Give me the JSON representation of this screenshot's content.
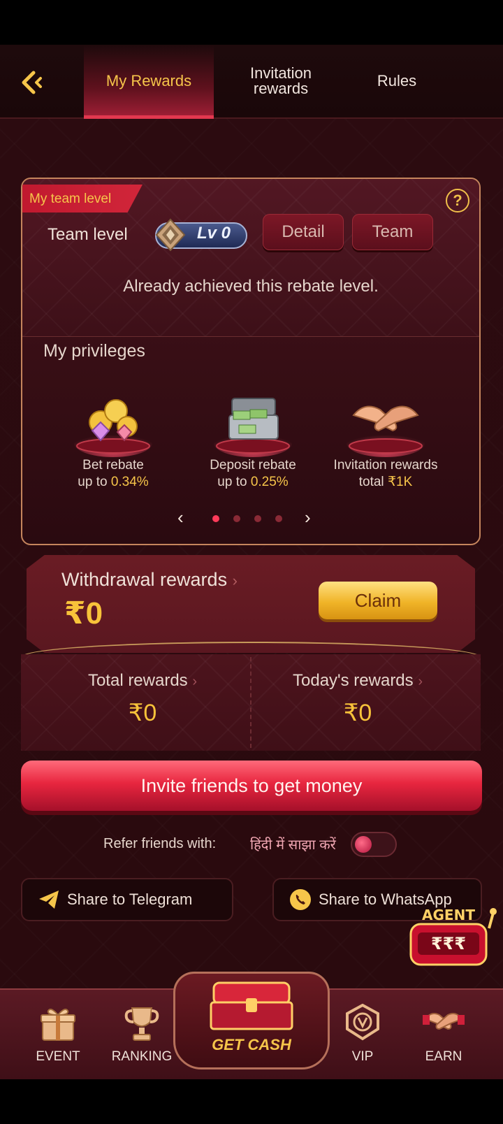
{
  "header": {
    "tabs": [
      {
        "label": "My Rewards",
        "active": true
      },
      {
        "label_line1": "Invitation",
        "label_line2": "rewards"
      },
      {
        "label": "Rules"
      }
    ]
  },
  "team_card": {
    "ribbon": "My team level",
    "team_level_label": "Team level",
    "level_badge": "Lv 0",
    "detail_button": "Detail",
    "team_button": "Team",
    "status_text": "Already achieved this rebate level.",
    "privileges_title": "My privileges",
    "privileges": [
      {
        "line1": "Bet rebate",
        "line2_prefix": "up to ",
        "line2_value": "0.34%"
      },
      {
        "line1": "Deposit rebate",
        "line2_prefix": "up to ",
        "line2_value": "0.25%"
      },
      {
        "line1": "Invitation rewards",
        "line2_prefix": "total ",
        "line2_value": "₹1K"
      }
    ],
    "pager": {
      "pages": 4,
      "active": 0
    }
  },
  "withdrawal": {
    "title": "Withdrawal rewards",
    "amount": "₹0",
    "claim_button": "Claim"
  },
  "totals": {
    "total_label": "Total rewards",
    "total_value": "₹0",
    "today_label": "Today's rewards",
    "today_value": "₹0"
  },
  "invite_button": "Invite friends to get money",
  "refer": {
    "label": "Refer friends with:",
    "hindi": "हिंदी में साझा करें",
    "toggle_on": false
  },
  "share": {
    "telegram": "Share to Telegram",
    "whatsapp": "Share to WhatsApp"
  },
  "agent_badge": {
    "text": "AGENT",
    "symbols": "₹₹₹"
  },
  "bottom_nav": {
    "event": "EVENT",
    "ranking": "RANKING",
    "get_cash": "GET CASH",
    "vip": "VIP",
    "earn": "EARN"
  },
  "colors": {
    "accent_gold": "#f6c54a",
    "accent_red": "#e8263f",
    "background": "#2a0b0f"
  }
}
